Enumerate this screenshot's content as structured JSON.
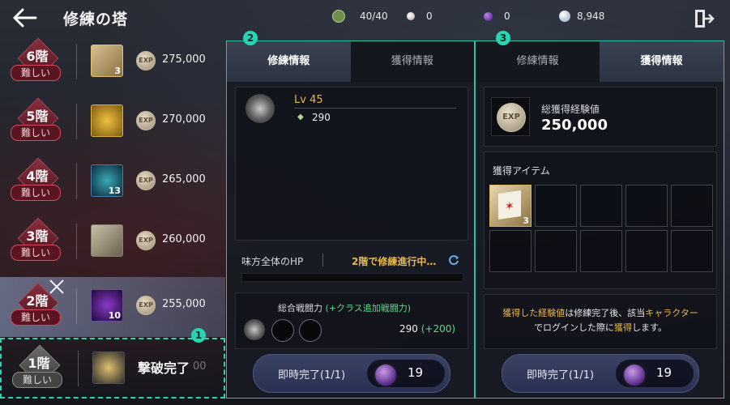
{
  "header": {
    "title": "修練の塔",
    "resources": [
      {
        "icon": "stamina-icon",
        "value": "40/40",
        "color": "#7a9a5a"
      },
      {
        "icon": "pearl-icon",
        "value": "0",
        "color": "#d8c8c8"
      },
      {
        "icon": "purple-gem-icon",
        "value": "0",
        "color": "#7a3ab8"
      },
      {
        "icon": "silver-coin-icon",
        "value": "8,948",
        "color": "#c8d8e8"
      }
    ]
  },
  "floors": [
    {
      "floor": "6階",
      "difficulty": "難しい",
      "item_count": "3",
      "exp": "275,000"
    },
    {
      "floor": "5階",
      "difficulty": "難しい",
      "item_count": "",
      "exp": "270,000"
    },
    {
      "floor": "4階",
      "difficulty": "難しい",
      "item_count": "13",
      "exp": "265,000"
    },
    {
      "floor": "3階",
      "difficulty": "難しい",
      "item_count": "",
      "exp": "260,000"
    },
    {
      "floor": "2階",
      "difficulty": "難しい",
      "item_count": "10",
      "exp": "255,000"
    },
    {
      "floor": "1階",
      "difficulty": "難しい",
      "item_count": "",
      "status": "撃破完了",
      "exp_partial": "00"
    }
  ],
  "markers": [
    "1",
    "2",
    "3"
  ],
  "panel_training": {
    "tab_active": "修練情報",
    "tab_other": "獲得情報",
    "level": "Lv 45",
    "power": "290",
    "hp_label": "味方全体のHP",
    "hp_status": "2階で修練進行中…",
    "power_label": "総合戦闘力",
    "power_bonus_label": "(+クラス追加戦闘力)",
    "power_value": "290",
    "power_bonus": "(+200)",
    "button_label": "即時完了(1/1)",
    "button_cost": "19"
  },
  "panel_reward": {
    "tab_other": "修練情報",
    "tab_active": "獲得情報",
    "total_exp_label": "総獲得経験値",
    "total_exp": "250,000",
    "items_label": "獲得アイテム",
    "item_count": "3",
    "notice_part1": "獲得した経験値",
    "notice_part2": "は修練完了後、該当",
    "notice_part3": "キャラクター",
    "notice_part4": "でログインした際に",
    "notice_part5": "獲得",
    "notice_part6": "します。",
    "button_label": "即時完了(1/1)",
    "button_cost": "19"
  },
  "exp_icon_text": "EXP",
  "colors": {
    "accent": "#2bd3b5",
    "gold": "#e8b84a",
    "green": "#5fd88a"
  }
}
